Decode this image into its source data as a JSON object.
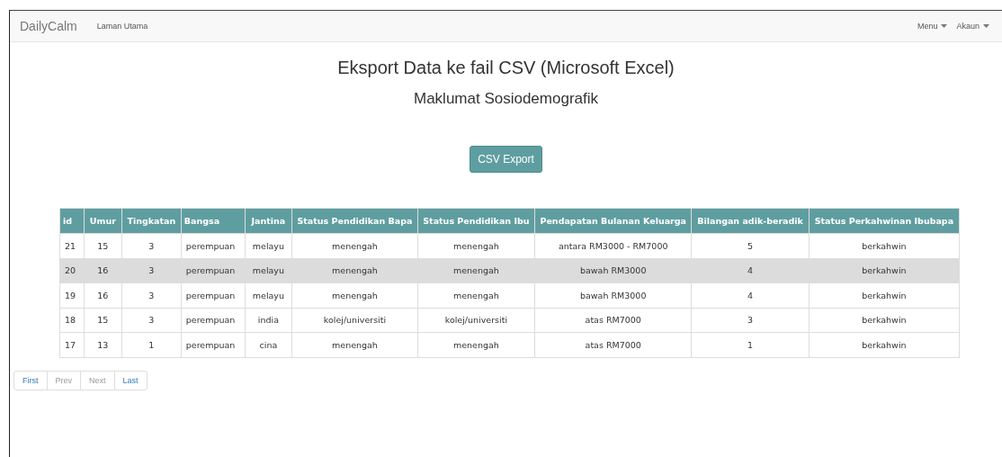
{
  "navbar": {
    "brand": "DailyCalm",
    "links": [
      "Laman Utama"
    ],
    "menus": [
      "Menu",
      "Akaun"
    ]
  },
  "title": "Eksport Data ke fail CSV (Microsoft Excel)",
  "subtitle": "Maklumat Sosiodemografik",
  "export_button": "CSV Export",
  "table": {
    "columns": [
      "id",
      "Umur",
      "Tingkatan",
      "Bangsa",
      "Jantina",
      "Status Pendidikan Bapa",
      "Status Pendidikan Ibu",
      "Pendapatan Bulanan Keluarga",
      "Bilangan adik-beradik",
      "Status Perkahwinan Ibubapa"
    ],
    "rows": [
      {
        "selected": false,
        "cells": [
          "21",
          "15",
          "3",
          "perempuan",
          "melayu",
          "menengah",
          "menengah",
          "antara RM3000 - RM7000",
          "5",
          "berkahwin"
        ]
      },
      {
        "selected": true,
        "cells": [
          "20",
          "16",
          "3",
          "perempuan",
          "melayu",
          "menengah",
          "menengah",
          "bawah RM3000",
          "4",
          "berkahwin"
        ]
      },
      {
        "selected": false,
        "cells": [
          "19",
          "16",
          "3",
          "perempuan",
          "melayu",
          "menengah",
          "menengah",
          "bawah RM3000",
          "4",
          "berkahwin"
        ]
      },
      {
        "selected": false,
        "cells": [
          "18",
          "15",
          "3",
          "perempuan",
          "india",
          "kolej/universiti",
          "kolej/universiti",
          "atas RM7000",
          "3",
          "berkahwin"
        ]
      },
      {
        "selected": false,
        "cells": [
          "17",
          "13",
          "1",
          "perempuan",
          "cina",
          "menengah",
          "menengah",
          "atas RM7000",
          "1",
          "berkahwin"
        ]
      }
    ]
  },
  "pagination": [
    {
      "label": "First",
      "disabled": false
    },
    {
      "label": "Prev",
      "disabled": true
    },
    {
      "label": "Next",
      "disabled": true
    },
    {
      "label": "Last",
      "disabled": false
    }
  ]
}
